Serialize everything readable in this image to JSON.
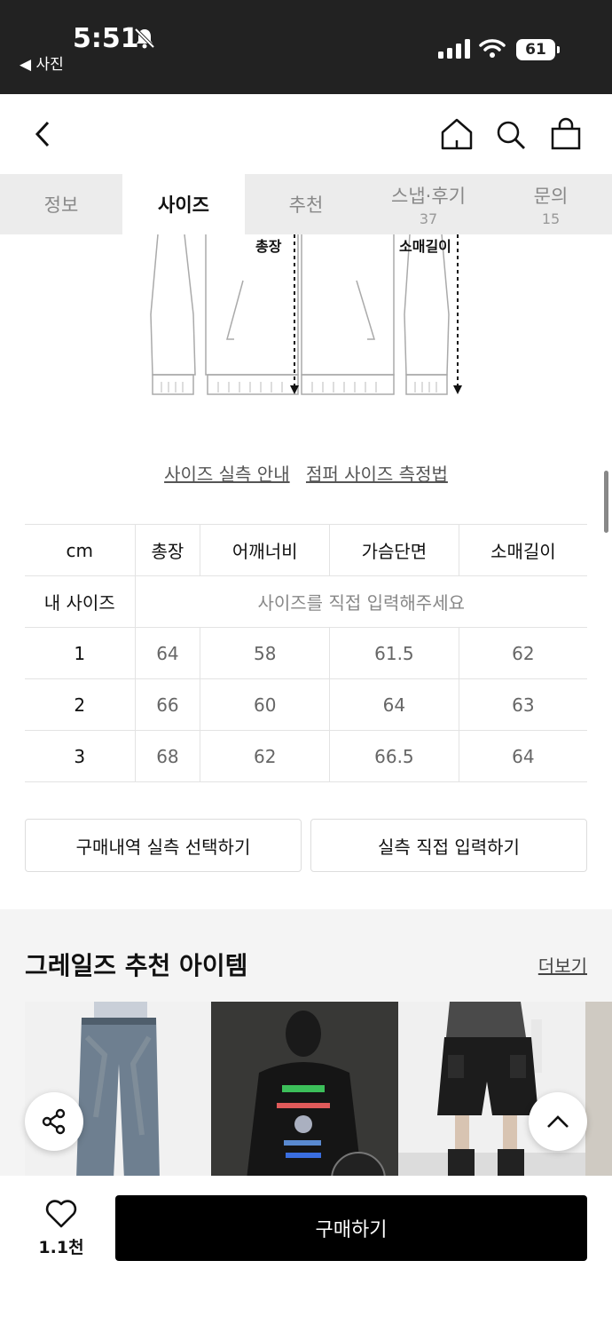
{
  "status_bar": {
    "time": "5:51",
    "back_app": "◀ 사진",
    "battery": "61"
  },
  "tabs": [
    {
      "label": "정보",
      "count": ""
    },
    {
      "label": "사이즈",
      "count": ""
    },
    {
      "label": "추천",
      "count": ""
    },
    {
      "label": "스냅·후기",
      "count": "37"
    },
    {
      "label": "문의",
      "count": "15"
    }
  ],
  "diagram": {
    "label_total": "총장",
    "label_sleeve": "소매길이"
  },
  "guide_links": {
    "guide": "사이즈 실측 안내",
    "method": "점퍼 사이즈 측정법"
  },
  "size_table": {
    "headers": [
      "cm",
      "총장",
      "어깨너비",
      "가슴단면",
      "소매길이"
    ],
    "my_size_label": "내 사이즈",
    "my_size_placeholder": "사이즈를 직접 입력해주세요",
    "rows": [
      [
        "1",
        "64",
        "58",
        "61.5",
        "62"
      ],
      [
        "2",
        "66",
        "60",
        "64",
        "63"
      ],
      [
        "3",
        "68",
        "62",
        "66.5",
        "64"
      ]
    ]
  },
  "buttons": {
    "history": "구매내역 실측 선택하기",
    "direct": "실측 직접 입력하기"
  },
  "recommend": {
    "title": "그레일즈 추천 아이템",
    "more": "더보기"
  },
  "bottom": {
    "like_count": "1.1천",
    "buy": "구매하기"
  }
}
